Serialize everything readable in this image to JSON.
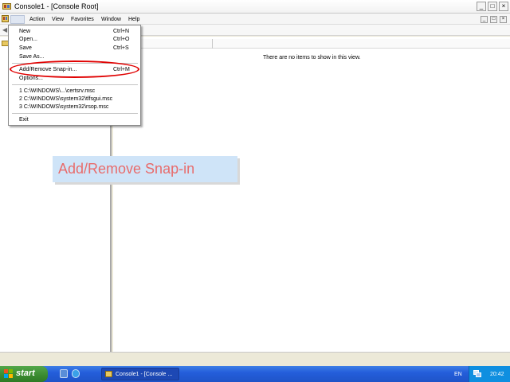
{
  "window": {
    "title": "Console1 - [Console Root]",
    "minimize_glyph": "_",
    "maximize_glyph": "□",
    "close_glyph": "×"
  },
  "menubar": {
    "items": [
      "File",
      "Action",
      "View",
      "Favorites",
      "Window",
      "Help"
    ]
  },
  "file_menu": {
    "items": [
      {
        "label": "New",
        "shortcut": "Ctrl+N"
      },
      {
        "label": "Open...",
        "shortcut": "Ctrl+O"
      },
      {
        "label": "Save",
        "shortcut": "Ctrl+S"
      },
      {
        "label": "Save As..."
      },
      {
        "label": "Add/Remove Snap-in...",
        "shortcut": "Ctrl+M"
      },
      {
        "label": "Options..."
      },
      {
        "label": "1 C:\\WINDOWS\\...\\certsrv.msc"
      },
      {
        "label": "2 C:\\WINDOWS\\system32\\tlfsgui.msc"
      },
      {
        "label": "3 C:\\WINDOWS\\system32\\rsop.msc"
      },
      {
        "label": "Exit"
      }
    ]
  },
  "list_view": {
    "empty_message": "There are no items to show in this view."
  },
  "callout": {
    "text": "Add/Remove Snap-in"
  },
  "taskbar": {
    "start_label": "start",
    "task_label": "Console1 - [Console ...",
    "language": "EN",
    "clock": "20:42"
  },
  "colors": {
    "highlight_ellipse": "#e00000",
    "callout_bg": "#cfe4f8",
    "callout_text": "#e86c6c",
    "taskbar": "#245edb",
    "start_button": "#3a8a2f"
  },
  "icons": {
    "app": "mmc-console-icon",
    "back": "back-arrow-icon",
    "tree_root": "folder-icon",
    "start": "windows-flag-icon",
    "quick_launch": [
      "show-desktop-icon",
      "internet-explorer-icon"
    ],
    "tray": "network-icon"
  }
}
